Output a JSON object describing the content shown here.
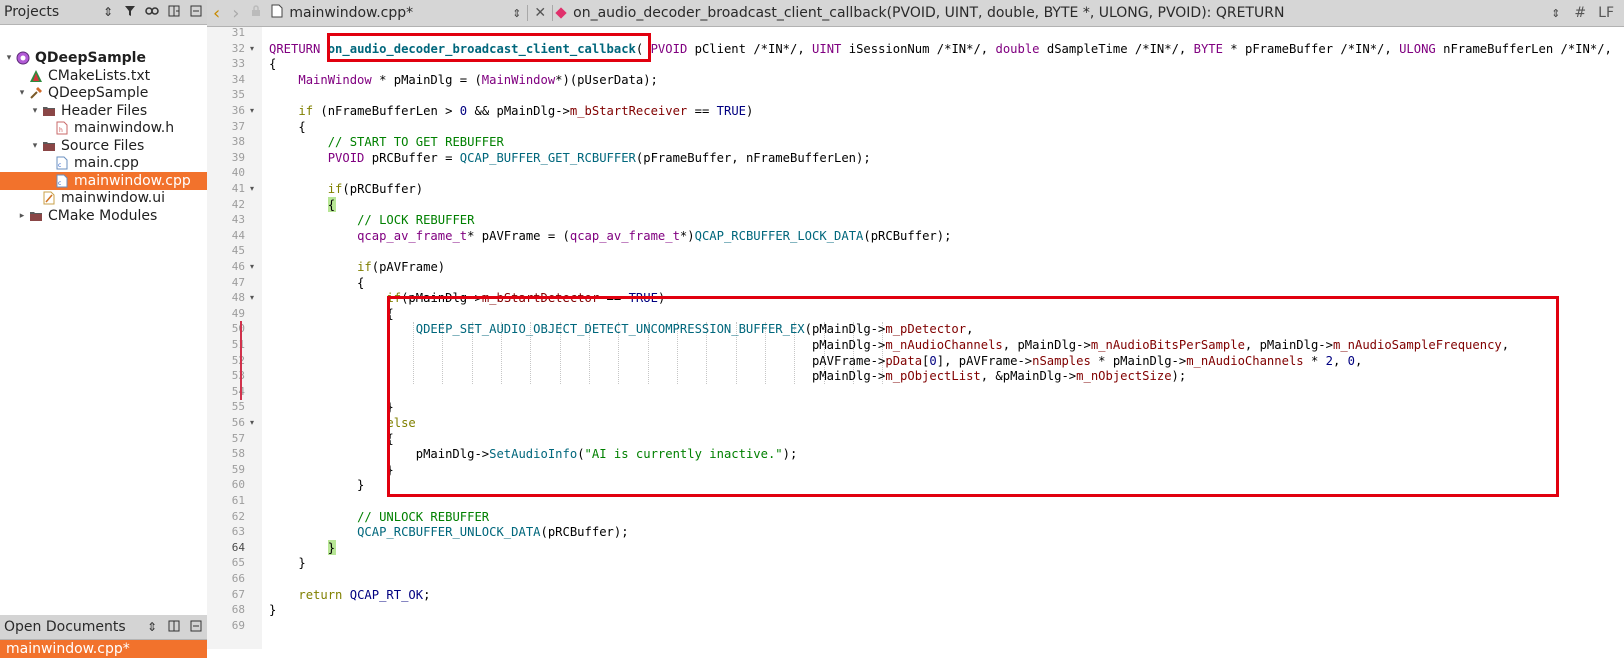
{
  "projects_panel": {
    "title": "Projects",
    "items": [
      {
        "label": "QDeepSample",
        "icon": "qt-project-icon",
        "depth": 0,
        "arrow": "▾",
        "bold": true
      },
      {
        "label": "CMakeLists.txt",
        "icon": "cmake-file-icon",
        "depth": 1,
        "arrow": ""
      },
      {
        "label": "QDeepSample",
        "icon": "hammer-icon",
        "depth": 1,
        "arrow": "▾"
      },
      {
        "label": "Header Files",
        "icon": "folder-icon",
        "depth": 2,
        "arrow": "▾"
      },
      {
        "label": "mainwindow.h",
        "icon": "header-file-icon",
        "depth": 3,
        "arrow": ""
      },
      {
        "label": "Source Files",
        "icon": "folder-icon",
        "depth": 2,
        "arrow": "▾"
      },
      {
        "label": "main.cpp",
        "icon": "cpp-file-icon",
        "depth": 3,
        "arrow": ""
      },
      {
        "label": "mainwindow.cpp",
        "icon": "cpp-file-icon",
        "depth": 3,
        "arrow": "",
        "selected": true
      },
      {
        "label": "mainwindow.ui",
        "icon": "ui-file-icon",
        "depth": 2,
        "arrow": ""
      },
      {
        "label": "CMake Modules",
        "icon": "folder-icon",
        "depth": 1,
        "arrow": "▸"
      }
    ]
  },
  "open_documents": {
    "title": "Open Documents",
    "items": [
      "mainwindow.cpp*"
    ]
  },
  "toolbar": {
    "back": "‹",
    "forward": "›",
    "file_name": "mainwindow.cpp*",
    "function_signature": "on_audio_decoder_broadcast_client_callback(PVOID, UINT, double, BYTE *, ULONG, PVOID): QRETURN",
    "hash": "#",
    "line_ending": "LF"
  },
  "editor": {
    "current_line": 64,
    "lines": [
      {
        "n": 31,
        "t": ""
      },
      {
        "n": 32,
        "t": "QRETURN on_audio_decoder_broadcast_client_callback( PVOID pClient /*IN*/, UINT iSessionNum /*IN*/, double dSampleTime /*IN*/, BYTE * pFrameBuffer /*IN*/, ULONG nFrameBufferLen /*IN*/,"
      },
      {
        "n": 33,
        "t": "{"
      },
      {
        "n": 34,
        "t": "    MainWindow * pMainDlg = (MainWindow*)(pUserData);"
      },
      {
        "n": 35,
        "t": ""
      },
      {
        "n": 36,
        "t": "    if (nFrameBufferLen > 0 && pMainDlg->m_bStartReceiver == TRUE)"
      },
      {
        "n": 37,
        "t": "    {"
      },
      {
        "n": 38,
        "t": "        // START TO GET REBUFFER"
      },
      {
        "n": 39,
        "t": "        PVOID pRCBuffer = QCAP_BUFFER_GET_RCBUFFER(pFrameBuffer, nFrameBufferLen);"
      },
      {
        "n": 40,
        "t": ""
      },
      {
        "n": 41,
        "t": "        if(pRCBuffer)"
      },
      {
        "n": 42,
        "t": "        {"
      },
      {
        "n": 43,
        "t": "            // LOCK REBUFFER"
      },
      {
        "n": 44,
        "t": "            qcap_av_frame_t* pAVFrame = (qcap_av_frame_t*)QCAP_RCBUFFER_LOCK_DATA(pRCBuffer);"
      },
      {
        "n": 45,
        "t": ""
      },
      {
        "n": 46,
        "t": "            if(pAVFrame)"
      },
      {
        "n": 47,
        "t": "            {"
      },
      {
        "n": 48,
        "t": "                if(pMainDlg->m_bStartDetector == TRUE)"
      },
      {
        "n": 49,
        "t": "                {"
      },
      {
        "n": 50,
        "t": "                    QDEEP_SET_AUDIO_OBJECT_DETECT_UNCOMPRESSION_BUFFER_EX(pMainDlg->m_pDetector,"
      },
      {
        "n": 51,
        "t": "                                                                          pMainDlg->m_nAudioChannels, pMainDlg->m_nAudioBitsPerSample, pMainDlg->m_nAudioSampleFrequency,"
      },
      {
        "n": 52,
        "t": "                                                                          pAVFrame->pData[0], pAVFrame->nSamples * pMainDlg->m_nAudioChannels * 2, 0,"
      },
      {
        "n": 53,
        "t": "                                                                          pMainDlg->m_pObjectList, &pMainDlg->m_nObjectSize);"
      },
      {
        "n": 54,
        "t": ""
      },
      {
        "n": 55,
        "t": "                }"
      },
      {
        "n": 56,
        "t": "                else"
      },
      {
        "n": 57,
        "t": "                {"
      },
      {
        "n": 58,
        "t": "                    pMainDlg->SetAudioInfo(\"AI is currently inactive.\");"
      },
      {
        "n": 59,
        "t": "                }"
      },
      {
        "n": 60,
        "t": "            }"
      },
      {
        "n": 61,
        "t": ""
      },
      {
        "n": 62,
        "t": "            // UNLOCK REBUFFER"
      },
      {
        "n": 63,
        "t": "            QCAP_RCBUFFER_UNLOCK_DATA(pRCBuffer);"
      },
      {
        "n": 64,
        "t": "        }"
      },
      {
        "n": 65,
        "t": "    }"
      },
      {
        "n": 66,
        "t": ""
      },
      {
        "n": 67,
        "t": "    return QCAP_RT_OK;"
      },
      {
        "n": 68,
        "t": "}"
      },
      {
        "n": 69,
        "t": ""
      }
    ]
  },
  "colors": {
    "selection": "#f2722c",
    "annotation_box": "#e1000f",
    "keyword": "#808000",
    "type": "#800080",
    "function": "#00677c",
    "member": "#800000",
    "comment": "#008000"
  }
}
